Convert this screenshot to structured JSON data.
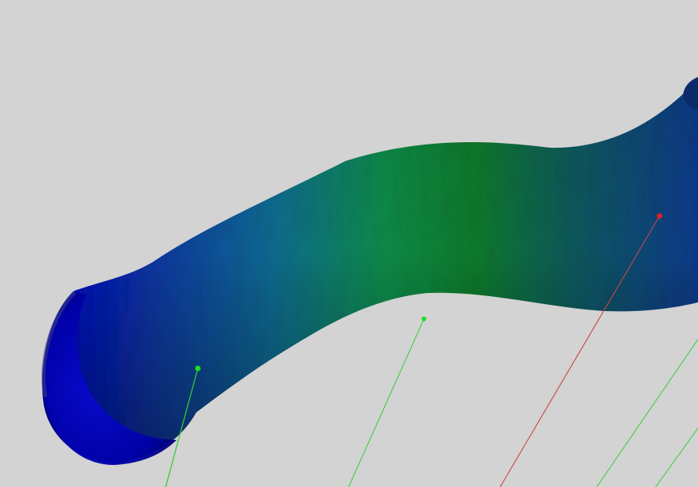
{
  "scene": {
    "background_color": "#d3d3d3",
    "mesh": {
      "kind": "tubular-surface",
      "colormap": [
        "#0000cc",
        "#0a5aa0",
        "#0f8a5a",
        "#0e7a2a",
        "#0a4a7a",
        "#0a3a8a"
      ]
    },
    "markers": [
      {
        "name": "marker-1",
        "color": "#22dd22"
      },
      {
        "name": "marker-2",
        "color": "#22dd22"
      },
      {
        "name": "marker-3",
        "color": "#dd2222"
      }
    ],
    "leader_line_colors": {
      "green": "#33cc33",
      "red": "#cc4444"
    }
  }
}
